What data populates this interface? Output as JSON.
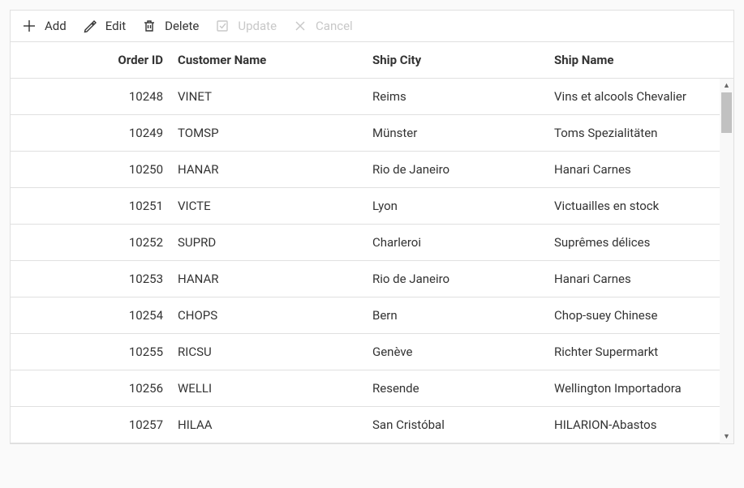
{
  "toolbar": {
    "add": "Add",
    "edit": "Edit",
    "delete": "Delete",
    "update": "Update",
    "cancel": "Cancel"
  },
  "columns": {
    "orderId": "Order ID",
    "customerName": "Customer Name",
    "shipCity": "Ship City",
    "shipName": "Ship Name"
  },
  "rows": [
    {
      "orderId": "10248",
      "customerName": "VINET",
      "shipCity": "Reims",
      "shipName": "Vins et alcools Chevalier"
    },
    {
      "orderId": "10249",
      "customerName": "TOMSP",
      "shipCity": "Münster",
      "shipName": "Toms Spezialitäten"
    },
    {
      "orderId": "10250",
      "customerName": "HANAR",
      "shipCity": "Rio de Janeiro",
      "shipName": "Hanari Carnes"
    },
    {
      "orderId": "10251",
      "customerName": "VICTE",
      "shipCity": "Lyon",
      "shipName": "Victuailles en stock"
    },
    {
      "orderId": "10252",
      "customerName": "SUPRD",
      "shipCity": "Charleroi",
      "shipName": "Suprêmes délices"
    },
    {
      "orderId": "10253",
      "customerName": "HANAR",
      "shipCity": "Rio de Janeiro",
      "shipName": "Hanari Carnes"
    },
    {
      "orderId": "10254",
      "customerName": "CHOPS",
      "shipCity": "Bern",
      "shipName": "Chop-suey Chinese"
    },
    {
      "orderId": "10255",
      "customerName": "RICSU",
      "shipCity": "Genève",
      "shipName": "Richter Supermarkt"
    },
    {
      "orderId": "10256",
      "customerName": "WELLI",
      "shipCity": "Resende",
      "shipName": "Wellington Importadora"
    },
    {
      "orderId": "10257",
      "customerName": "HILAA",
      "shipCity": "San Cristóbal",
      "shipName": "HILARION-Abastos"
    }
  ]
}
